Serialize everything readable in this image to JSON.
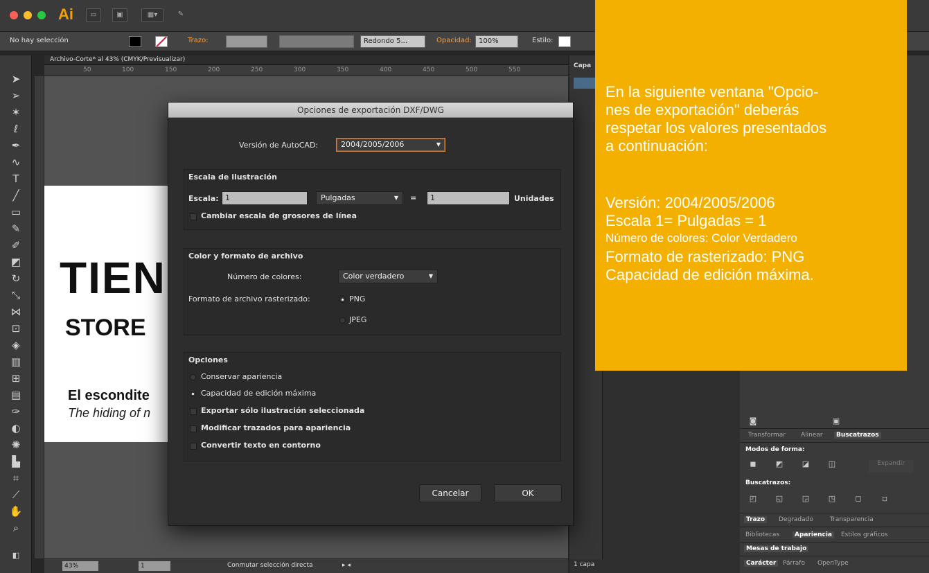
{
  "app": {
    "logo": "Ai"
  },
  "titlebar": {
    "colors": {
      "close": "#fc5f57",
      "minimize": "#fdbc2e",
      "zoom": "#28c940"
    }
  },
  "controlbar": {
    "selection": "No hay selección",
    "stroke_label": "Trazo:",
    "brush": "Redondo 5...",
    "opacity_label": "Opacidad:",
    "opacity_value": "100%",
    "style_label": "Estilo:"
  },
  "document": {
    "tab": "Archivo-Corte* al 43% (CMYK/Previsualizar)",
    "ruler_numbers": [
      "50",
      "100",
      "150",
      "200",
      "250",
      "300",
      "350",
      "400",
      "450",
      "500",
      "550"
    ]
  },
  "artboard": {
    "title": "TIEN",
    "store": "STORE",
    "line1": "El escondite",
    "line2": "The hiding of n"
  },
  "statusbar": {
    "zoom": "43%",
    "page": "1",
    "hint": "Conmutar selección directa"
  },
  "layers": {
    "title": "Capa",
    "count": "1 capa"
  },
  "dock": {
    "tabs_row1": [
      "Transformar",
      "Alinear",
      "Buscatrazos"
    ],
    "shape_modes": "Modos de forma:",
    "expand": "Expandir",
    "pathfinders": "Buscatrazos:",
    "tabs_row2": [
      "Trazo",
      "Degradado",
      "Transparencia"
    ],
    "tabs_row3": [
      "Bibliotecas",
      "Apariencia",
      "Estilos gráficos"
    ],
    "artboards": "Mesas de trabajo",
    "tabs_row4": [
      "Carácter",
      "Párrafo",
      "OpenType"
    ]
  },
  "dialog": {
    "title": "Opciones de exportación DXF/DWG",
    "autocad_label": "Versión de AutoCAD:",
    "autocad_value": "2004/2005/2006",
    "scale_group": "Escala de ilustración",
    "scale_label": "Escala:",
    "scale_value": "1",
    "units_value": "Pulgadas",
    "equals": "=",
    "units_count": "1",
    "units_label": "Unidades",
    "scale_lineweights": "Cambiar escala de grosores de línea",
    "color_group": "Color y formato de archivo",
    "colors_label": "Número de colores:",
    "colors_value": "Color verdadero",
    "raster_label": "Formato de archivo rasterizado:",
    "raster_png": "PNG",
    "raster_jpeg": "JPEG",
    "options_group": "Opciones",
    "opt_appearance": "Conservar apariencia",
    "opt_editability": "Capacidad de edición máxima",
    "opt_selected": "Exportar sólo ilustración seleccionada",
    "opt_paths": "Modificar trazados para apariencia",
    "opt_outline": "Convertir texto en contorno",
    "cancel": "Cancelar",
    "ok": "OK"
  },
  "overlay": {
    "color": "#f3b000",
    "intro": [
      "En la siguiente ventana \"Opcio-",
      "nes de exportación\"  deberás",
      "respetar los valores presentados",
      "a continuación:"
    ],
    "values": [
      "Versión: 2004/2005/2006",
      "Escala 1= Pulgadas = 1",
      "Número de colores: Color Verdadero",
      "Formato de rasterizado: PNG",
      "Capacidad de edición máxima."
    ]
  }
}
